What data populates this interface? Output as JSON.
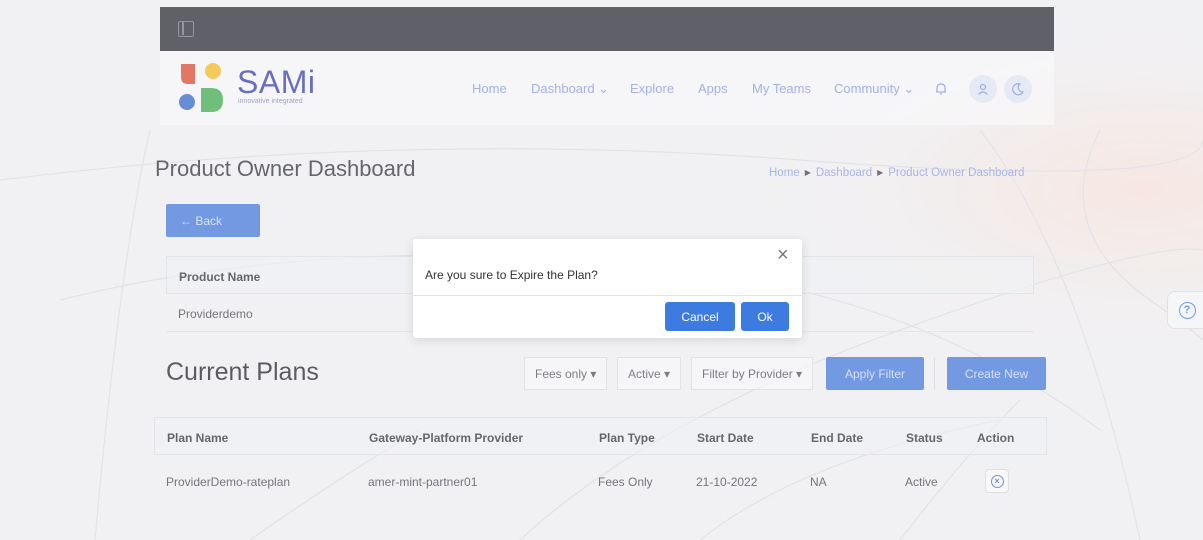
{
  "brand": {
    "name": "SAMi",
    "tagline": "innovative integrated",
    "colors": {
      "primary": "#3f72d8",
      "red": "#d9432b",
      "yellow": "#f2b51d",
      "green": "#39a54a",
      "blue": "#2d61c7",
      "navy": "#2e3aa5"
    }
  },
  "nav": {
    "items": [
      {
        "label": "Home"
      },
      {
        "label": "Dashboard",
        "icon": "chevron-down-icon"
      },
      {
        "label": "Explore"
      },
      {
        "label": "Apps"
      },
      {
        "label": "My Teams"
      },
      {
        "label": "Community",
        "icon": "chevron-down-icon"
      }
    ],
    "icons": [
      "bell-icon",
      "user-icon",
      "moon-icon"
    ]
  },
  "page": {
    "title": "Product Owner Dashboard",
    "breadcrumb": [
      "Home",
      "Dashboard",
      "Product Owner Dashboard"
    ],
    "back_label": "← Back"
  },
  "product_table": {
    "header": "Product Name",
    "rows": [
      "Providerdemo"
    ]
  },
  "plans": {
    "title": "Current Plans",
    "filters": {
      "fees": "Fees only ▾",
      "status": "Active ▾",
      "provider": "Filter by Provider ▾"
    },
    "apply_label": "Apply Filter",
    "create_label": "Create New",
    "columns": [
      "Plan Name",
      "Gateway-Platform Provider",
      "Plan Type",
      "Start Date",
      "End Date",
      "Status",
      "Action"
    ],
    "rows": [
      {
        "plan_name": "ProviderDemo-rateplan",
        "provider": "amer-mint-partner01",
        "plan_type": "Fees Only",
        "start_date": "21-10-2022",
        "end_date": "NA",
        "status": "Active",
        "action_icon": "close-circle-icon"
      }
    ]
  },
  "help": {
    "icon": "help-icon",
    "glyph": "?"
  },
  "modal": {
    "message": "Are you sure to Expire the Plan?",
    "close_glyph": "×",
    "cancel_label": "Cancel",
    "ok_label": "Ok"
  }
}
